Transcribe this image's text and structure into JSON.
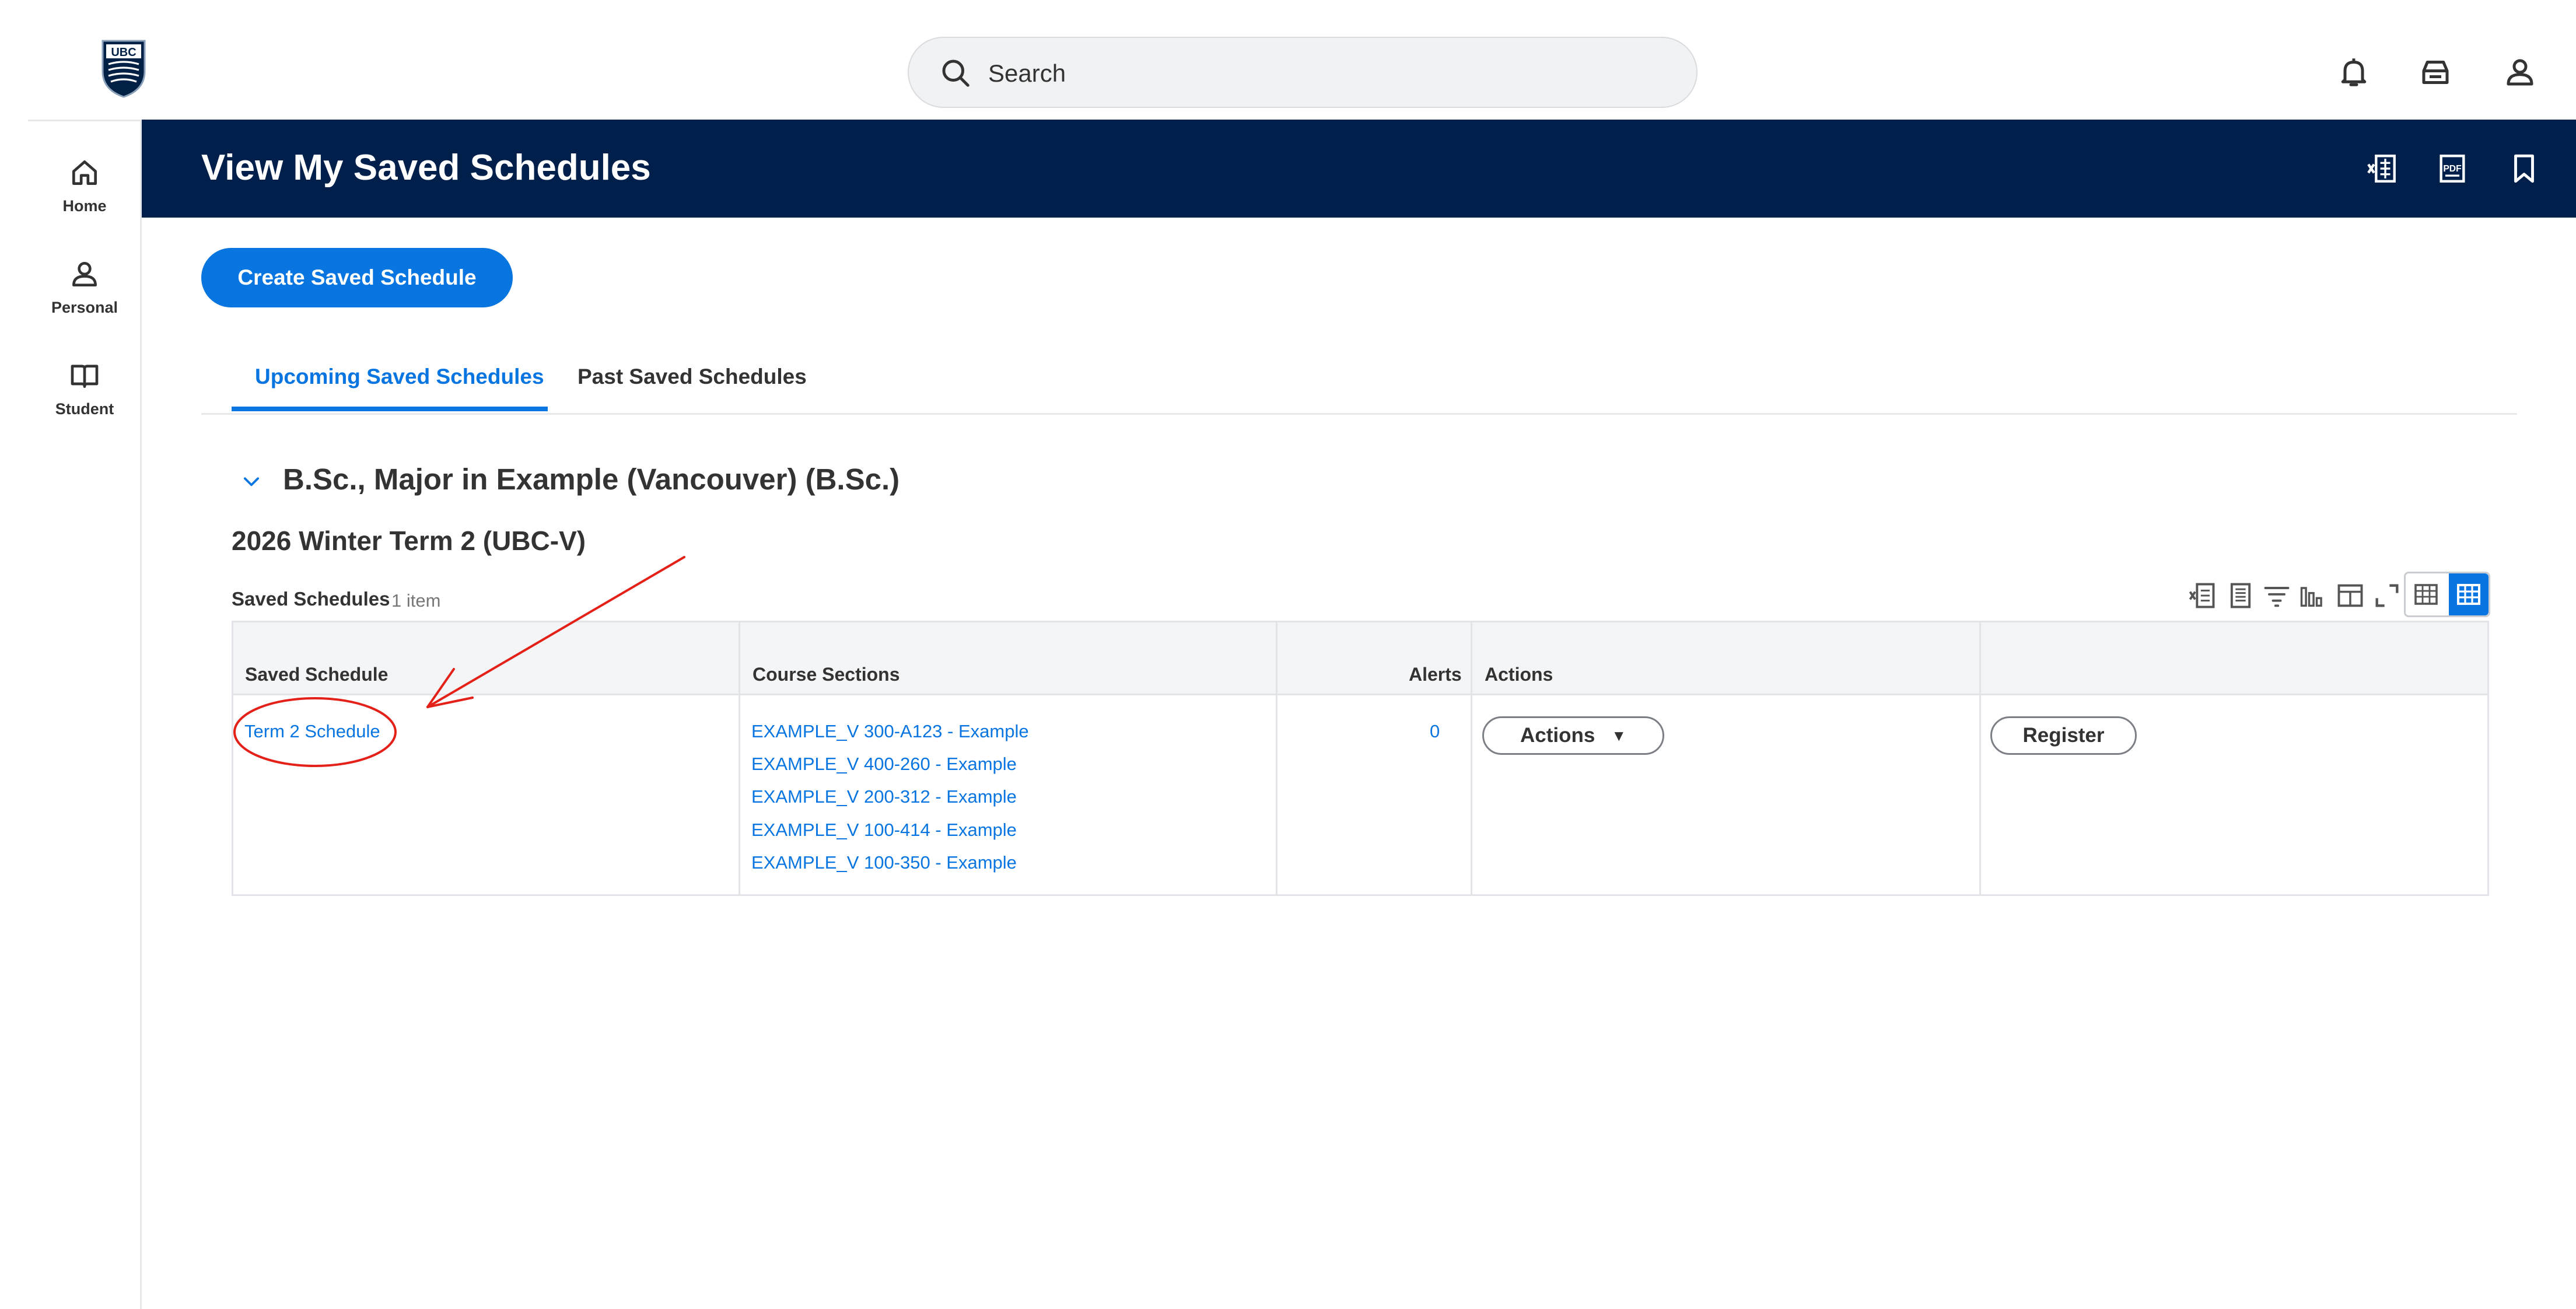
{
  "brand": {
    "logo_text": "UBC",
    "colors": {
      "header": "#00204b",
      "accent": "#0875e1",
      "annotation": "#e32119"
    }
  },
  "search": {
    "placeholder": "Search"
  },
  "top_icons": [
    "bell-icon",
    "inbox-icon",
    "user-icon"
  ],
  "sidebar": {
    "items": [
      {
        "label": "Home",
        "icon": "home-icon"
      },
      {
        "label": "Personal",
        "icon": "person-icon"
      },
      {
        "label": "Student",
        "icon": "book-icon"
      }
    ]
  },
  "header": {
    "title": "View My Saved Schedules",
    "icons": [
      "export-excel-icon",
      "export-pdf-icon",
      "bookmark-icon"
    ]
  },
  "create_button": {
    "label": "Create Saved Schedule"
  },
  "tabs": [
    {
      "label": "Upcoming Saved Schedules",
      "active": true
    },
    {
      "label": "Past Saved Schedules",
      "active": false
    }
  ],
  "section": {
    "program": "B.Sc., Major in Example (Vancouver) (B.Sc.)",
    "term": "2026 Winter Term 2 (UBC-V)",
    "grid_title": "Saved Schedules",
    "grid_count": "1 item"
  },
  "table": {
    "headers": {
      "saved_schedule": "Saved Schedule",
      "course_sections": "Course Sections",
      "alerts": "Alerts",
      "actions": "Actions"
    },
    "rows": [
      {
        "saved_schedule": "Term 2 Schedule",
        "course_sections": [
          "EXAMPLE_V 300-A123 - Example",
          "EXAMPLE_V 400-260 - Example",
          "EXAMPLE_V 200-312 - Example",
          "EXAMPLE_V 100-414 - Example",
          "EXAMPLE_V 100-350 - Example"
        ],
        "alerts": "0",
        "actions_label": "Actions",
        "register_label": "Register"
      }
    ]
  }
}
